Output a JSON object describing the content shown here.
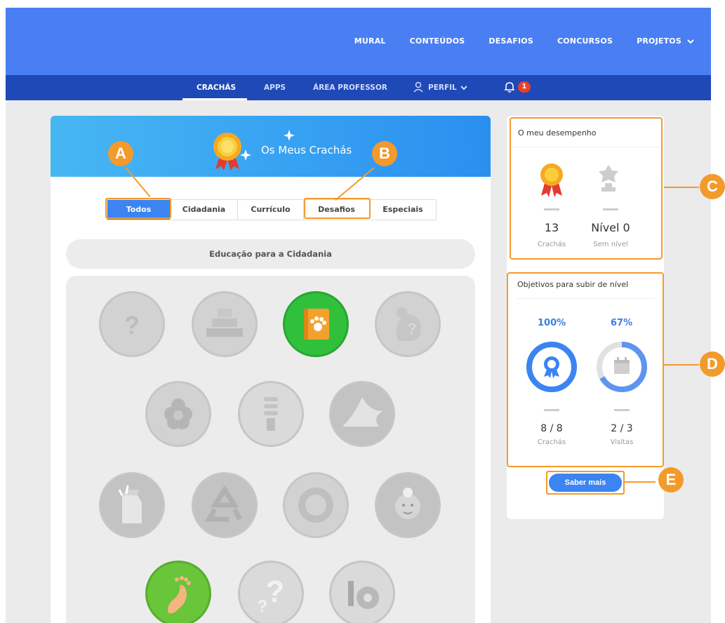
{
  "topnav": {
    "items": [
      "MURAL",
      "CONTEÚDOS",
      "DESAFIOS",
      "CONCURSOS",
      "PROJETOS"
    ]
  },
  "subnav": {
    "crachas": "CRACHÁS",
    "apps": "APPS",
    "professor": "ÁREA PROFESSOR",
    "perfil": "PERFIL",
    "notification_count": "1"
  },
  "banner": {
    "title": "Os Meus Crachás"
  },
  "tabs": [
    "Todos",
    "Cidadania",
    "Currículo",
    "Desafios",
    "Especiais"
  ],
  "section": {
    "title": "Educação para a Cidadania"
  },
  "badges": [
    {
      "icon": "question-badge-icon",
      "state": "locked"
    },
    {
      "icon": "bricks-badge-icon",
      "state": "locked"
    },
    {
      "icon": "paw-book-badge-icon",
      "state": "earned"
    },
    {
      "icon": "mouse-question-badge-icon",
      "state": "locked"
    },
    {
      "icon": "flower-badge-icon",
      "state": "locked"
    },
    {
      "icon": "lightbulb-badge-icon",
      "state": "locked"
    },
    {
      "icon": "banana-peel-badge-icon",
      "state": "locked"
    },
    {
      "icon": "milk-carton-badge-icon",
      "state": "locked"
    },
    {
      "icon": "recycle-badge-icon",
      "state": "locked"
    },
    {
      "icon": "refresh-badge-icon",
      "state": "locked"
    },
    {
      "icon": "kid-face-badge-icon",
      "state": "locked"
    },
    {
      "icon": "footprint-badge-icon",
      "state": "earned"
    },
    {
      "icon": "question-pair-badge-icon",
      "state": "locked"
    },
    {
      "icon": "gear-pencil-badge-icon",
      "state": "locked"
    }
  ],
  "performance": {
    "title": "O meu desempenho",
    "badges_count": "13",
    "badges_label": "Crachás",
    "level": "Nível 0",
    "level_label": "Sem nível"
  },
  "objectives": {
    "title": "Objetivos para subir de nível",
    "badges_pct": "100%",
    "visits_pct": "67%",
    "badges_progress": 1.0,
    "visits_progress": 0.67,
    "badges_value": "8 / 8",
    "badges_label": "Crachás",
    "visits_value": "2 / 3",
    "visits_label": "Visitas"
  },
  "saber_mais": "Saber mais",
  "markers": [
    "A",
    "B",
    "C",
    "D",
    "E"
  ],
  "colors": {
    "topbar": "#4a7ff3",
    "subbar": "#1f49b6",
    "accent": "#3b84f1",
    "marker": "#f39a2c",
    "earned_green": "#31c03c"
  }
}
